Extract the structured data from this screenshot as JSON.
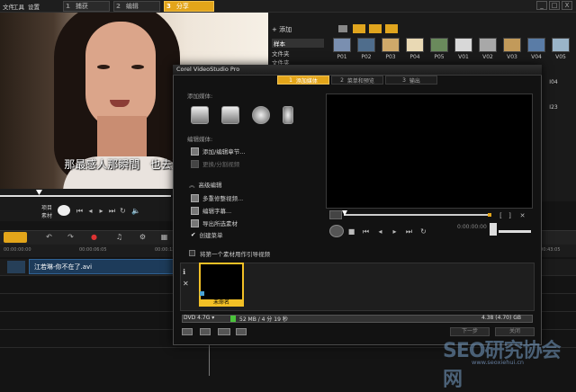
{
  "menu": {
    "items": [
      "文件",
      "工具",
      "设置"
    ]
  },
  "steps": [
    {
      "num": "1",
      "label": "捕获"
    },
    {
      "num": "2",
      "label": "编辑"
    },
    {
      "num": "3",
      "label": "分享"
    }
  ],
  "window_buttons": [
    "_",
    "□",
    "X"
  ],
  "preview": {
    "subtitle_left": "那最感人那瞬間",
    "subtitle_right": "也去過不少",
    "project_label": "项目",
    "clip_label": "素材"
  },
  "library": {
    "add_label": "添加",
    "categories": [
      "样本",
      "文件夹",
      "文件夹"
    ],
    "thumbs_row1": [
      "P01",
      "P02",
      "P03",
      "P04",
      "P05",
      "V01",
      "V02",
      "V03",
      "V04",
      "V05"
    ],
    "thumbs_row2_right": [
      "I04",
      "I23"
    ]
  },
  "timeline": {
    "clip_name": "江若琳-你不在了.avi",
    "timecodes": [
      "00:00:00:00",
      "00:00:06:05",
      "00:00:12:10",
      "00:00:18:15",
      "00:00:24:20",
      "00:00:30:25",
      "00:00:37:00",
      "00:00:43:05"
    ]
  },
  "dialog": {
    "title": "Corel VideoStudio Pro",
    "tabs": [
      {
        "num": "1",
        "label": "添加媒体"
      },
      {
        "num": "2",
        "label": "菜单和预览"
      },
      {
        "num": "3",
        "label": "输出"
      }
    ],
    "add_media_label": "添加媒体:",
    "edit_media_label": "编辑媒体:",
    "edit_items": [
      "添加/编辑章节...",
      "更换/分割视频"
    ],
    "advanced_label": "高级编辑",
    "advanced_items": [
      "多重修整视频...",
      "编辑字幕...",
      "导出所选素材"
    ],
    "create_menu_label": "创建菜单",
    "first_clip_label": "将第一个素材用作引导视频",
    "thumb_label": "未命名",
    "dvd_type": "DVD 4.7G",
    "dvd_size_text": "52 MB / 4 分 19 秒",
    "dvd_total": "4.38 (4.70) GB",
    "buttons": [
      "下一步",
      "关闭"
    ],
    "time_readout": "0:00:00:00"
  },
  "watermark": {
    "text": "SEO研究协会网",
    "url": "www.seoxiehui.cn"
  },
  "colors": {
    "accent": "#e3a51a",
    "clip_blue": "#1d3b5a",
    "progress_green": "#4ac33a"
  }
}
